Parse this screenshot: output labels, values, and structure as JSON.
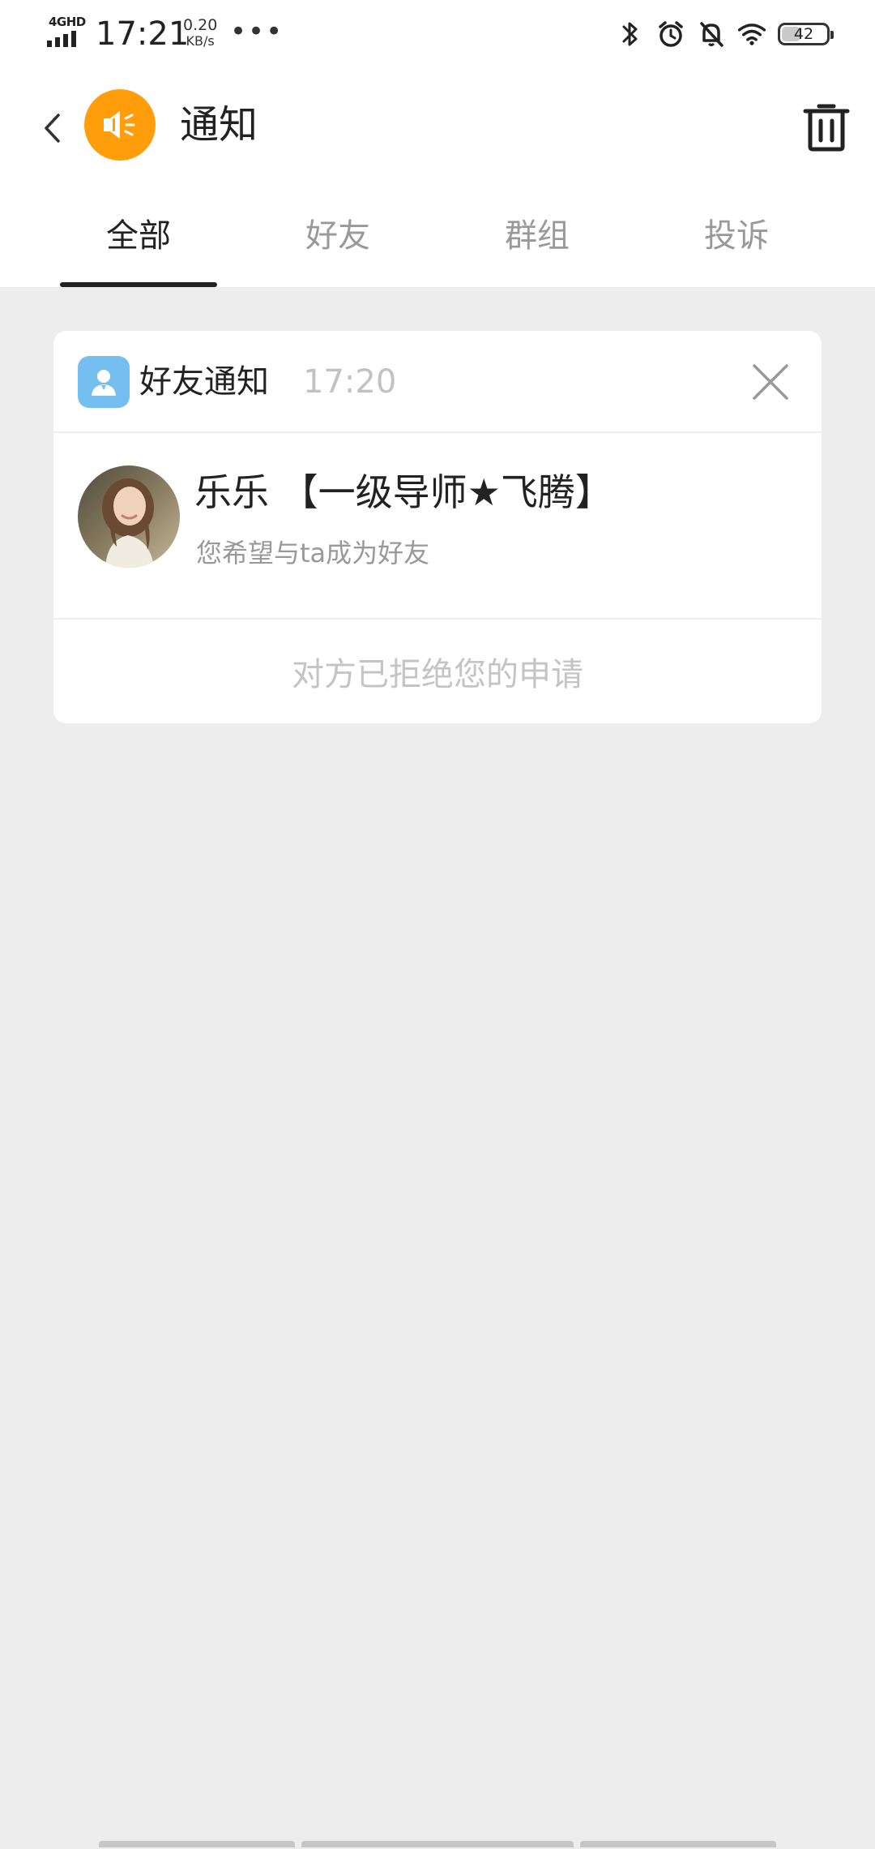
{
  "status_bar": {
    "network": "4GHD",
    "time": "17:21",
    "speed_value": "0.20",
    "speed_unit": "KB/s",
    "more": "•••",
    "battery_level": "42",
    "battery_fraction": 0.42,
    "icons": [
      "signal-icon",
      "bluetooth-icon",
      "alarm-icon",
      "bell-off-icon",
      "wifi-icon",
      "battery-icon"
    ]
  },
  "header": {
    "title": "通知",
    "avatar_color": "#ff9d0a",
    "icons": [
      "back-arrow-icon",
      "speaker-icon",
      "trash-icon"
    ]
  },
  "tabs": [
    {
      "label": "全部",
      "active": true
    },
    {
      "label": "好友",
      "active": false
    },
    {
      "label": "群组",
      "active": false
    },
    {
      "label": "投诉",
      "active": false
    }
  ],
  "notification": {
    "category": "好友通知",
    "time": "17:20",
    "category_icon_color": "#74bff0",
    "user": {
      "name": "乐乐 【一级导师★飞腾】",
      "message": "您希望与ta成为好友"
    },
    "status": "对方已拒绝您的申请"
  },
  "colors": {
    "accent_orange": "#ff9d0a",
    "background": "#ededed",
    "muted_text": "#999999"
  }
}
